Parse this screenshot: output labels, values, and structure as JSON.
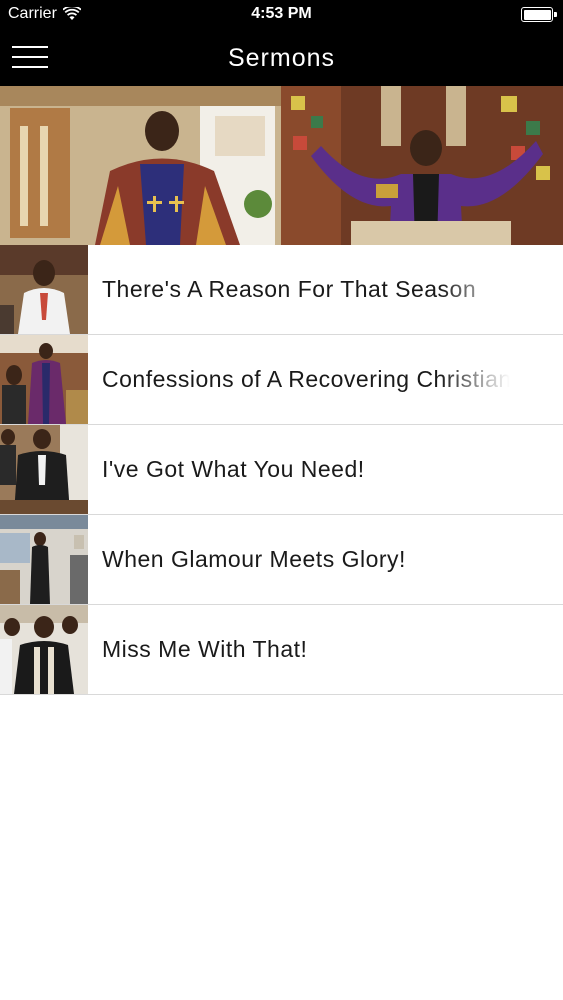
{
  "status_bar": {
    "carrier": "Carrier",
    "time": "4:53 PM"
  },
  "nav": {
    "title": "Sermons"
  },
  "sermons": [
    {
      "title": "There's A Reason For That Season"
    },
    {
      "title": "Confessions of A Recovering Christian"
    },
    {
      "title": "I've Got What You Need!"
    },
    {
      "title": "When Glamour Meets Glory!"
    },
    {
      "title": "Miss Me With That!"
    }
  ],
  "colors": {
    "bar_background": "#000000",
    "bar_text": "#ffffff",
    "row_text": "#1a1a1a",
    "divider": "#d9d9d9"
  }
}
